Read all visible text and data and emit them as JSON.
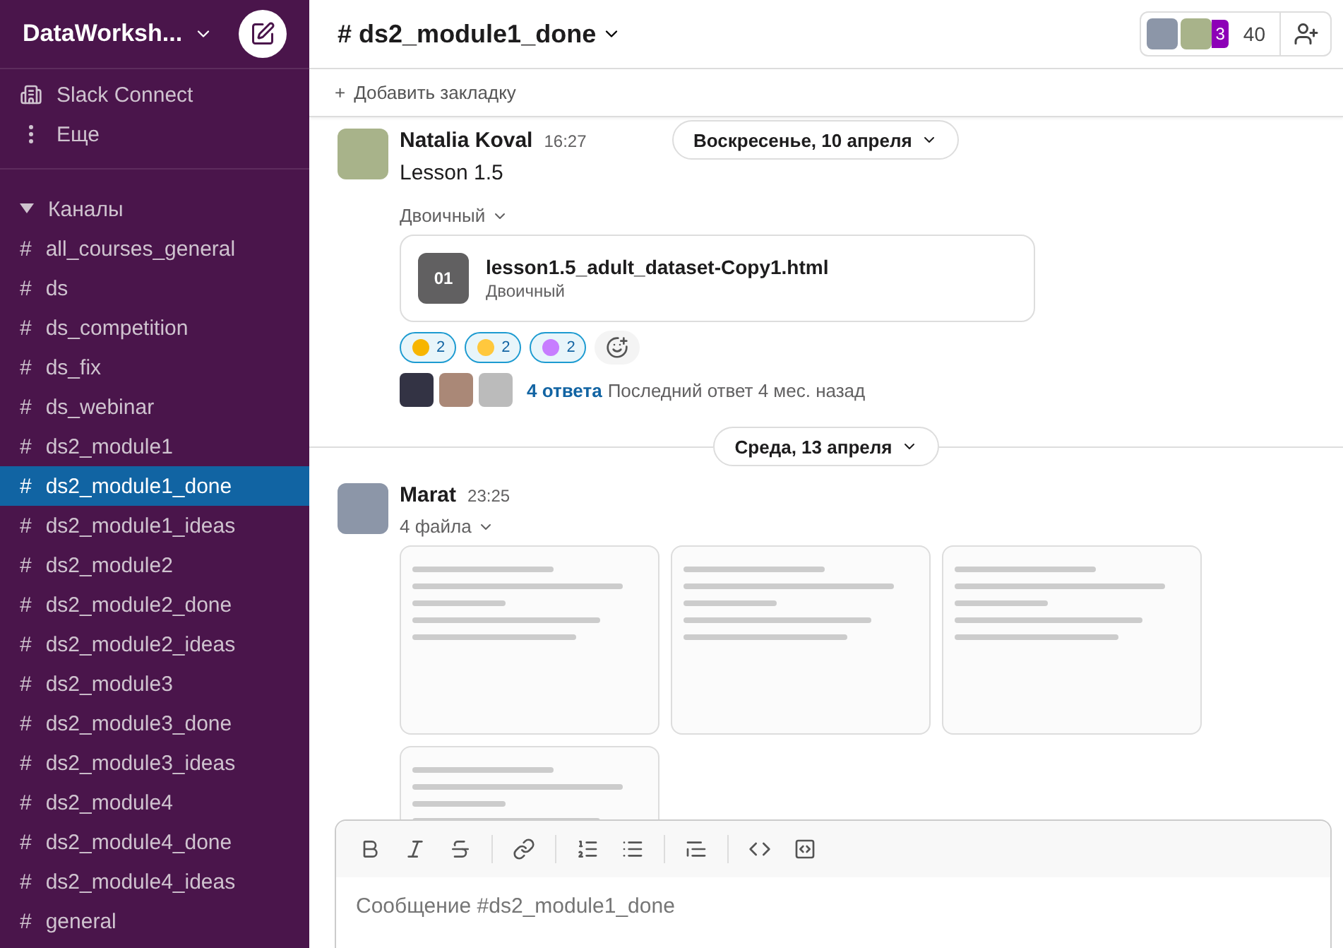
{
  "workspace": {
    "name": "DataWorksh..."
  },
  "sidebar": {
    "nav": [
      {
        "kind": "connect",
        "label": "Slack Connect"
      },
      {
        "kind": "more",
        "label": "Еще"
      }
    ],
    "section": {
      "label": "Каналы",
      "expanded": true
    },
    "channels": [
      {
        "symbol": "#",
        "name": "all_courses_general",
        "selected": false
      },
      {
        "symbol": "#",
        "name": "ds",
        "selected": false
      },
      {
        "symbol": "#",
        "name": "ds_competition",
        "selected": false
      },
      {
        "symbol": "#",
        "name": "ds_fix",
        "selected": false
      },
      {
        "symbol": "#",
        "name": "ds_webinar",
        "selected": false
      },
      {
        "symbol": "#",
        "name": "ds2_module1",
        "selected": false
      },
      {
        "symbol": "#",
        "name": "ds2_module1_done",
        "selected": true
      },
      {
        "symbol": "#",
        "name": "ds2_module1_ideas",
        "selected": false
      },
      {
        "symbol": "#",
        "name": "ds2_module2",
        "selected": false
      },
      {
        "symbol": "#",
        "name": "ds2_module2_done",
        "selected": false
      },
      {
        "symbol": "#",
        "name": "ds2_module2_ideas",
        "selected": false
      },
      {
        "symbol": "#",
        "name": "ds2_module3",
        "selected": false
      },
      {
        "symbol": "#",
        "name": "ds2_module3_done",
        "selected": false
      },
      {
        "symbol": "#",
        "name": "ds2_module3_ideas",
        "selected": false
      },
      {
        "symbol": "#",
        "name": "ds2_module4",
        "selected": false
      },
      {
        "symbol": "#",
        "name": "ds2_module4_done",
        "selected": false
      },
      {
        "symbol": "#",
        "name": "ds2_module4_ideas",
        "selected": false
      },
      {
        "symbol": "#",
        "name": "general",
        "selected": false
      }
    ]
  },
  "header": {
    "hash": "#",
    "channel": "ds2_module1_done",
    "extra_members": "3",
    "member_count": "40"
  },
  "bookmark_bar": {
    "plus": "+",
    "label": "Добавить закладку"
  },
  "messages": [
    {
      "kind": "file",
      "author": "Natalia Koval",
      "time": "16:27",
      "text": "Lesson 1.5",
      "divider": "Воскресенье, 10 апреля",
      "file_type": "Двоичный",
      "file": {
        "badge": "01",
        "name": "lesson1.5_adult_dataset-Copy1.html",
        "type": "Двоичный"
      },
      "reactions": [
        {
          "count": "2"
        },
        {
          "count": "2"
        },
        {
          "count": "2"
        }
      ],
      "thread": {
        "replies": "4 ответа",
        "last": "Последний ответ 4 мес. назад"
      }
    },
    {
      "kind": "images",
      "author": "Marat",
      "time": "23:25",
      "divider": "Среда, 13 апреля",
      "file_type": "4 файла"
    }
  ],
  "composer": {
    "placeholder": "Сообщение #ds2_module1_done"
  }
}
